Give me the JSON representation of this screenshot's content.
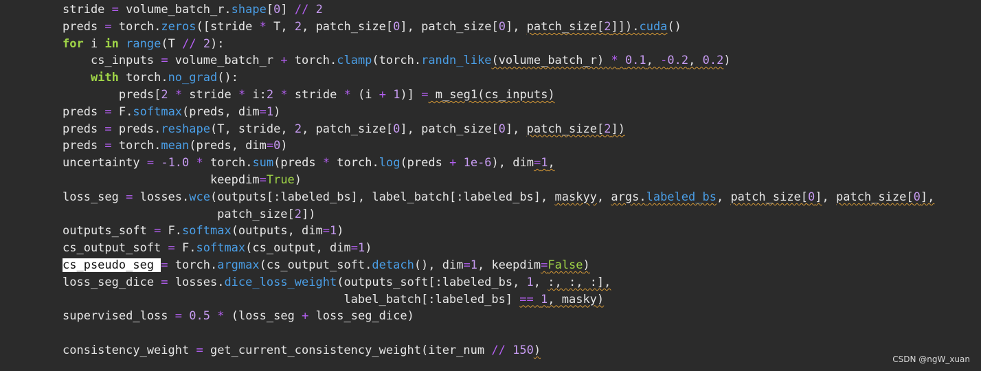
{
  "editor": {
    "lines": [
      {
        "indent": 0,
        "tokens": [
          {
            "t": "stride "
          },
          {
            "t": "=",
            "k": "op"
          },
          {
            "t": " volume_batch_r."
          },
          {
            "t": "shape",
            "k": "fn"
          },
          {
            "t": "["
          },
          {
            "t": "0",
            "k": "num"
          },
          {
            "t": "] "
          },
          {
            "t": "//",
            "k": "op"
          },
          {
            "t": " "
          },
          {
            "t": "2",
            "k": "num"
          }
        ]
      },
      {
        "indent": 0,
        "tokens": [
          {
            "t": "preds "
          },
          {
            "t": "=",
            "k": "op"
          },
          {
            "t": " torch."
          },
          {
            "t": "zeros",
            "k": "fn"
          },
          {
            "t": "([stride "
          },
          {
            "t": "*",
            "k": "op"
          },
          {
            "t": " T, "
          },
          {
            "t": "2",
            "k": "num"
          },
          {
            "t": ", patch_size["
          },
          {
            "t": "0",
            "k": "num"
          },
          {
            "t": "], patch_size["
          },
          {
            "t": "0",
            "k": "num"
          },
          {
            "t": "], "
          },
          {
            "t": "patch_size[",
            "s": 1
          },
          {
            "t": "2",
            "k": "num",
            "s": 1
          },
          {
            "t": "]]).",
            "s": 1
          },
          {
            "t": "cuda",
            "k": "fn",
            "s": 1
          },
          {
            "t": "()"
          }
        ]
      },
      {
        "indent": 0,
        "tokens": [
          {
            "t": "for",
            "k": "kw"
          },
          {
            "t": " i "
          },
          {
            "t": "in",
            "k": "kw"
          },
          {
            "t": " "
          },
          {
            "t": "range",
            "k": "fn"
          },
          {
            "t": "(T "
          },
          {
            "t": "//",
            "k": "op"
          },
          {
            "t": " "
          },
          {
            "t": "2",
            "k": "num"
          },
          {
            "t": "):"
          }
        ]
      },
      {
        "indent": 1,
        "tokens": [
          {
            "t": "cs_inputs "
          },
          {
            "t": "=",
            "k": "op"
          },
          {
            "t": " volume_batch_r "
          },
          {
            "t": "+",
            "k": "op"
          },
          {
            "t": " torch."
          },
          {
            "t": "clamp",
            "k": "fn"
          },
          {
            "t": "(torch."
          },
          {
            "t": "randn_like",
            "k": "fn"
          },
          {
            "t": "(volume_batch_r) ",
            "s": 1
          },
          {
            "t": "*",
            "k": "op",
            "s": 1
          },
          {
            "t": " ",
            "s": 1
          },
          {
            "t": "0.1",
            "k": "num",
            "s": 1
          },
          {
            "t": ", ",
            "s": 1
          },
          {
            "t": "-",
            "k": "op",
            "s": 1
          },
          {
            "t": "0.2",
            "k": "num",
            "s": 1
          },
          {
            "t": ", ",
            "s": 1
          },
          {
            "t": "0.2",
            "k": "num",
            "s": 1
          },
          {
            "t": ")"
          }
        ]
      },
      {
        "indent": 1,
        "tokens": [
          {
            "t": "with",
            "k": "kw"
          },
          {
            "t": " torch."
          },
          {
            "t": "no_grad",
            "k": "fn"
          },
          {
            "t": "():"
          }
        ]
      },
      {
        "indent": 2,
        "tokens": [
          {
            "t": "preds["
          },
          {
            "t": "2",
            "k": "num"
          },
          {
            "t": " "
          },
          {
            "t": "*",
            "k": "op"
          },
          {
            "t": " stride "
          },
          {
            "t": "*",
            "k": "op"
          },
          {
            "t": " i:"
          },
          {
            "t": "2",
            "k": "num"
          },
          {
            "t": " "
          },
          {
            "t": "*",
            "k": "op"
          },
          {
            "t": " stride "
          },
          {
            "t": "*",
            "k": "op"
          },
          {
            "t": " (i "
          },
          {
            "t": "+",
            "k": "op"
          },
          {
            "t": " "
          },
          {
            "t": "1",
            "k": "num"
          },
          {
            "t": ")] "
          },
          {
            "t": "=",
            "k": "op"
          },
          {
            "t": " m_seg1(cs_inputs)",
            "s": 1
          }
        ]
      },
      {
        "indent": 0,
        "tokens": [
          {
            "t": "preds "
          },
          {
            "t": "=",
            "k": "op"
          },
          {
            "t": " F."
          },
          {
            "t": "softmax",
            "k": "fn"
          },
          {
            "t": "(preds, dim"
          },
          {
            "t": "=",
            "k": "op"
          },
          {
            "t": "1",
            "k": "num"
          },
          {
            "t": ")"
          }
        ]
      },
      {
        "indent": 0,
        "tokens": [
          {
            "t": "preds "
          },
          {
            "t": "=",
            "k": "op"
          },
          {
            "t": " preds."
          },
          {
            "t": "reshape",
            "k": "fn"
          },
          {
            "t": "(T, stride, "
          },
          {
            "t": "2",
            "k": "num"
          },
          {
            "t": ", patch_size["
          },
          {
            "t": "0",
            "k": "num"
          },
          {
            "t": "], patch_size["
          },
          {
            "t": "0",
            "k": "num"
          },
          {
            "t": "], "
          },
          {
            "t": "patch_size[",
            "s": 1
          },
          {
            "t": "2",
            "k": "num",
            "s": 1
          },
          {
            "t": "])",
            "s": 1
          }
        ]
      },
      {
        "indent": 0,
        "tokens": [
          {
            "t": "preds "
          },
          {
            "t": "=",
            "k": "op"
          },
          {
            "t": " torch."
          },
          {
            "t": "mean",
            "k": "fn"
          },
          {
            "t": "(preds, dim"
          },
          {
            "t": "=",
            "k": "op"
          },
          {
            "t": "0",
            "k": "num"
          },
          {
            "t": ")"
          }
        ]
      },
      {
        "indent": 0,
        "tokens": [
          {
            "t": "uncertainty "
          },
          {
            "t": "=",
            "k": "op"
          },
          {
            "t": " "
          },
          {
            "t": "-1.0",
            "k": "num"
          },
          {
            "t": " "
          },
          {
            "t": "*",
            "k": "op"
          },
          {
            "t": " torch."
          },
          {
            "t": "sum",
            "k": "fn"
          },
          {
            "t": "(preds "
          },
          {
            "t": "*",
            "k": "op"
          },
          {
            "t": " torch."
          },
          {
            "t": "log",
            "k": "fn"
          },
          {
            "t": "(preds "
          },
          {
            "t": "+",
            "k": "op"
          },
          {
            "t": " "
          },
          {
            "t": "1e-6",
            "k": "num"
          },
          {
            "t": "), dim"
          },
          {
            "t": "=",
            "k": "op",
            "s": 1
          },
          {
            "t": "1",
            "k": "num",
            "s": 1
          },
          {
            "t": ",",
            "s": 1
          }
        ]
      },
      {
        "indent": 0,
        "pad": "                     ",
        "tokens": [
          {
            "t": "keepdim"
          },
          {
            "t": "=",
            "k": "op"
          },
          {
            "t": "True",
            "k": "const"
          },
          {
            "t": ")"
          }
        ]
      },
      {
        "indent": 0,
        "tokens": [
          {
            "t": "loss_seg "
          },
          {
            "t": "=",
            "k": "op"
          },
          {
            "t": " losses."
          },
          {
            "t": "wce",
            "k": "fn"
          },
          {
            "t": "(outputs[:labeled_bs], label_batch[:labeled_bs], "
          },
          {
            "t": "maskyy",
            "s": 1
          },
          {
            "t": ", "
          },
          {
            "t": "args.",
            "s": 1
          },
          {
            "t": "labeled_bs",
            "k": "fn",
            "s": 1
          },
          {
            "t": ", "
          },
          {
            "t": "patch_size[",
            "s": 1
          },
          {
            "t": "0",
            "k": "num",
            "s": 1
          },
          {
            "t": "]",
            "s": 1
          },
          {
            "t": ", "
          },
          {
            "t": "patch_size[",
            "s": 1
          },
          {
            "t": "0",
            "k": "num",
            "s": 1
          },
          {
            "t": "],",
            "s": 1
          }
        ]
      },
      {
        "indent": 0,
        "pad": "                      ",
        "tokens": [
          {
            "t": "patch_size["
          },
          {
            "t": "2",
            "k": "num"
          },
          {
            "t": "])"
          }
        ]
      },
      {
        "indent": 0,
        "tokens": [
          {
            "t": "outputs_soft "
          },
          {
            "t": "=",
            "k": "op"
          },
          {
            "t": " F."
          },
          {
            "t": "softmax",
            "k": "fn"
          },
          {
            "t": "(outputs, dim"
          },
          {
            "t": "=",
            "k": "op"
          },
          {
            "t": "1",
            "k": "num"
          },
          {
            "t": ")"
          }
        ]
      },
      {
        "indent": 0,
        "tokens": [
          {
            "t": "cs_output_soft "
          },
          {
            "t": "=",
            "k": "op"
          },
          {
            "t": " F."
          },
          {
            "t": "softmax",
            "k": "fn"
          },
          {
            "t": "(cs_output, dim"
          },
          {
            "t": "=",
            "k": "op"
          },
          {
            "t": "1",
            "k": "num"
          },
          {
            "t": ")"
          }
        ]
      },
      {
        "indent": 0,
        "tokens": [
          {
            "t": "cs_pseudo_seg ",
            "k": "sel"
          },
          {
            "t": "=",
            "k": "op"
          },
          {
            "t": " torch."
          },
          {
            "t": "argmax",
            "k": "fn"
          },
          {
            "t": "(cs_output_soft."
          },
          {
            "t": "detach",
            "k": "fn"
          },
          {
            "t": "(), dim"
          },
          {
            "t": "=",
            "k": "op"
          },
          {
            "t": "1",
            "k": "num"
          },
          {
            "t": ", keepdim"
          },
          {
            "t": "=",
            "k": "op",
            "s": 1
          },
          {
            "t": "False",
            "k": "const",
            "s": 1
          },
          {
            "t": ")",
            "s": 1
          }
        ]
      },
      {
        "indent": 0,
        "tokens": [
          {
            "t": "loss_seg_dice "
          },
          {
            "t": "=",
            "k": "op"
          },
          {
            "t": " losses."
          },
          {
            "t": "dice_loss_weight",
            "k": "fn"
          },
          {
            "t": "(outputs_soft[:labeled_bs, "
          },
          {
            "t": "1",
            "k": "num"
          },
          {
            "t": ", "
          },
          {
            "t": ":, :, :],",
            "s": 1
          }
        ]
      },
      {
        "indent": 0,
        "pad": "                                        ",
        "tokens": [
          {
            "t": "label_batch[:labeled_bs] "
          },
          {
            "t": "==",
            "k": "op",
            "s": 1
          },
          {
            "t": " ",
            "s": 1
          },
          {
            "t": "1",
            "k": "num",
            "s": 1
          },
          {
            "t": ", masky)",
            "s": 1
          }
        ]
      },
      {
        "indent": 0,
        "tokens": [
          {
            "t": "supervised_loss "
          },
          {
            "t": "=",
            "k": "op"
          },
          {
            "t": " "
          },
          {
            "t": "0.5",
            "k": "num"
          },
          {
            "t": " "
          },
          {
            "t": "*",
            "k": "op"
          },
          {
            "t": " (loss_seg "
          },
          {
            "t": "+",
            "k": "op"
          },
          {
            "t": " loss_seg_dice)"
          }
        ]
      },
      {
        "indent": 0,
        "tokens": []
      },
      {
        "indent": 0,
        "tokens": [
          {
            "t": "consistency_weight "
          },
          {
            "t": "=",
            "k": "op"
          },
          {
            "t": " get_current_consistency_weight(iter_num "
          },
          {
            "t": "//",
            "k": "op"
          },
          {
            "t": " "
          },
          {
            "t": "150",
            "k": "num"
          },
          {
            "t": ")",
            "s": 1
          }
        ]
      }
    ]
  },
  "watermark": "CSDN @ngW_xuan",
  "colors": {
    "background": "#2b2b2b",
    "text": "#e6e6e6",
    "operator": "#b45ff2",
    "keyword": "#9fd447",
    "function": "#4a9ee6",
    "number": "#c79bf2",
    "squiggle": "#d79a36"
  }
}
